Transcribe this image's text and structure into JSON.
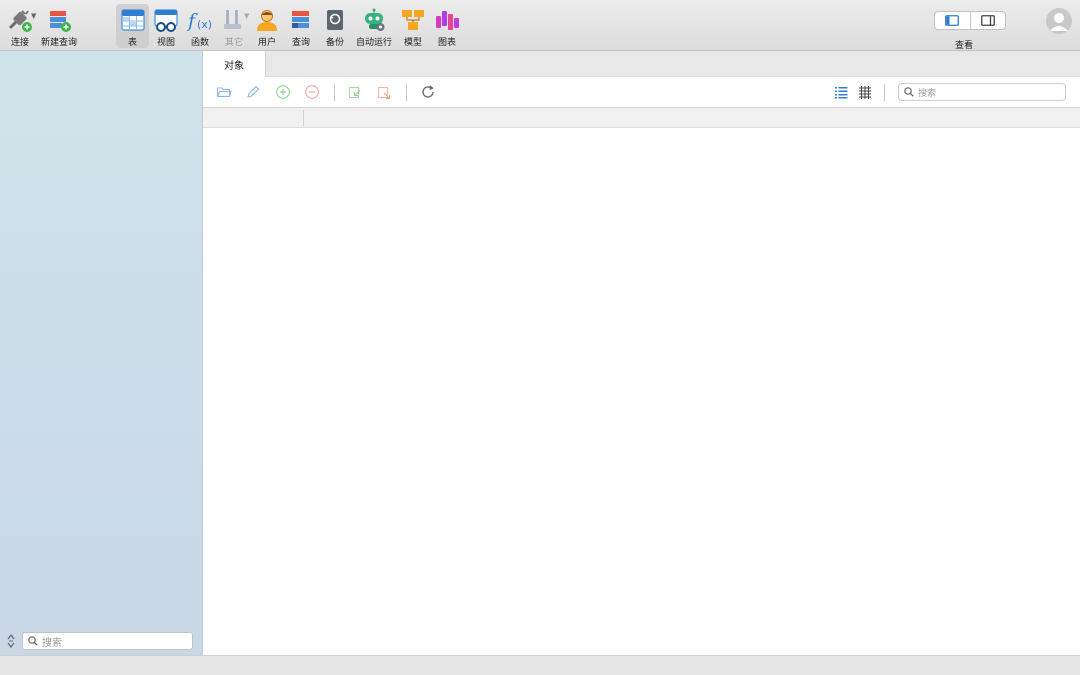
{
  "toolbar": {
    "items": [
      {
        "label": "连接",
        "icon": "plug-connect-icon"
      },
      {
        "label": "新建查询",
        "icon": "new-query-icon"
      },
      {
        "label": "表",
        "icon": "table-icon",
        "active": true
      },
      {
        "label": "视图",
        "icon": "view-glasses-icon"
      },
      {
        "label": "函数",
        "icon": "function-fx-icon"
      },
      {
        "label": "其它",
        "icon": "tools-icon",
        "disabled": true
      },
      {
        "label": "用户",
        "icon": "user-icon"
      },
      {
        "label": "查询",
        "icon": "query-icon"
      },
      {
        "label": "备份",
        "icon": "backup-icon"
      },
      {
        "label": "自动运行",
        "icon": "robot-automation-icon"
      },
      {
        "label": "模型",
        "icon": "model-icon"
      },
      {
        "label": "图表",
        "icon": "chart-icon"
      }
    ],
    "view_label": "查看"
  },
  "main": {
    "tab_label": "对象",
    "search_placeholder": "搜索"
  },
  "sidebar": {
    "search_placeholder": "搜索"
  },
  "colors": {
    "accent": "#2f7dd1",
    "add_green": "#5cc15c",
    "remove_red": "#e57373"
  }
}
